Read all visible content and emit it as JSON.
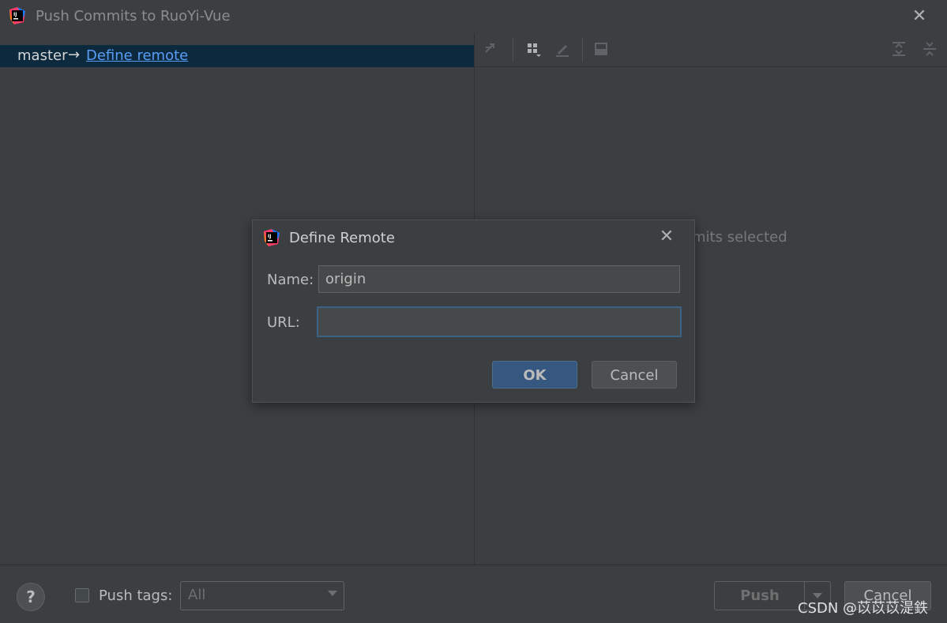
{
  "window": {
    "title": "Push Commits to RuoYi-Vue",
    "logo_icon": "intellij-logo-icon",
    "close_icon": "close-icon"
  },
  "left_pane": {
    "branch": "master",
    "arrow": "→",
    "define_remote_link": "Define remote"
  },
  "right_pane": {
    "toolbar_icons": [
      "merge-icon",
      "group-icon",
      "edit-icon",
      "preview-icon",
      "expand-all-icon",
      "collapse-all-icon"
    ],
    "empty_text": "mits selected"
  },
  "bottom_bar": {
    "help_label": "?",
    "push_tags_label": "Push tags:",
    "push_tags_underline_char": "t",
    "tags_select_value": "All",
    "push_button": "Push",
    "cancel_button": "Cancel",
    "watermark": "CSDN @苡苡苡湜鉄"
  },
  "modal": {
    "title": "Define Remote",
    "name_label": "Name:",
    "name_value": "origin",
    "url_label": "URL:",
    "url_value": "",
    "ok_button": "OK",
    "cancel_button": "Cancel"
  },
  "colors": {
    "background": "#3c3f41",
    "selection": "#0d293e",
    "link": "#589df6",
    "primary_button": "#365880",
    "focus_border": "#3d6185"
  }
}
